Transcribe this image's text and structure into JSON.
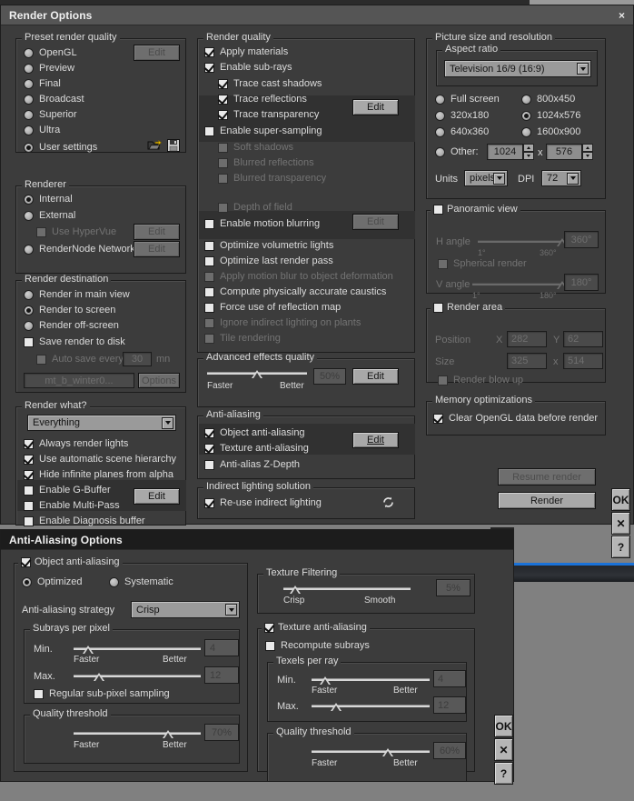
{
  "desktop": {
    "accent_color": "#1a72d8"
  },
  "render_options": {
    "title": "Render Options",
    "close_label": "×",
    "preset_render_quality": {
      "legend": "Preset render quality",
      "options": [
        "OpenGL",
        "Preview",
        "Final",
        "Broadcast",
        "Superior",
        "Ultra",
        "User settings"
      ],
      "selected": "User settings",
      "edit_label": "Edit",
      "edit_disabled": true,
      "load_icon": "folder-open-icon",
      "save_icon": "floppy-disk-icon"
    },
    "renderer": {
      "legend": "Renderer",
      "options": [
        "Internal",
        "External",
        "RenderNode Network"
      ],
      "selected": "Internal",
      "use_hypervue_label": "Use HyperVue",
      "use_hypervue_checked": false,
      "edit_external_label": "Edit",
      "edit_rendernode_label": "Edit"
    },
    "render_destination": {
      "legend": "Render destination",
      "options": [
        "Render in main view",
        "Render to screen",
        "Render off-screen"
      ],
      "selected": "Render to screen",
      "save_render_to_disk_label": "Save render to disk",
      "save_render_to_disk_checked": false,
      "auto_save_label": "Auto save every",
      "auto_save_checked": false,
      "auto_save_value": "30",
      "auto_save_unit": "mn",
      "file_name": "mt_b_winter0...",
      "options_button": "Options"
    },
    "render_what": {
      "legend": "Render what?",
      "combo_value": "Everything",
      "checkboxes": [
        {
          "label": "Always render lights",
          "checked": true
        },
        {
          "label": "Use automatic scene hierarchy",
          "checked": true
        },
        {
          "label": "Hide infinite planes from alpha",
          "checked": true
        },
        {
          "label": "Enable G-Buffer",
          "checked": false
        },
        {
          "label": "Enable Multi-Pass",
          "checked": false
        },
        {
          "label": "Enable Diagnosis buffer",
          "checked": false
        }
      ],
      "edit_label": "Edit"
    },
    "render_quality": {
      "legend": "Render quality",
      "items": [
        {
          "label": "Apply materials",
          "checked": true,
          "disabled": false,
          "indent": 0
        },
        {
          "label": "Enable sub-rays",
          "checked": true,
          "disabled": false,
          "indent": 0
        },
        {
          "label": "Trace cast shadows",
          "checked": true,
          "disabled": false,
          "indent": 1
        },
        {
          "label": "Trace reflections",
          "checked": true,
          "disabled": false,
          "indent": 1
        },
        {
          "label": "Trace transparency",
          "checked": true,
          "disabled": false,
          "indent": 1
        },
        {
          "label": "Enable super-sampling",
          "checked": false,
          "disabled": false,
          "indent": 0
        },
        {
          "label": "Soft shadows",
          "checked": false,
          "disabled": true,
          "indent": 1
        },
        {
          "label": "Blurred reflections",
          "checked": false,
          "disabled": true,
          "indent": 1
        },
        {
          "label": "Blurred transparency",
          "checked": false,
          "disabled": true,
          "indent": 1
        },
        {
          "label": "Depth of field",
          "checked": false,
          "disabled": true,
          "indent": 1
        },
        {
          "label": "Enable motion blurring",
          "checked": false,
          "disabled": false,
          "indent": 0
        },
        {
          "label": "Optimize volumetric lights",
          "checked": false,
          "disabled": false,
          "indent": 0
        },
        {
          "label": "Optimize last render pass",
          "checked": false,
          "disabled": false,
          "indent": 0
        },
        {
          "label": "Apply motion blur to object deformation",
          "checked": false,
          "disabled": true,
          "indent": 0
        },
        {
          "label": "Compute physically accurate caustics",
          "checked": false,
          "disabled": false,
          "indent": 0
        },
        {
          "label": "Force use of reflection map",
          "checked": false,
          "disabled": false,
          "indent": 0
        },
        {
          "label": "Ignore indirect lighting on plants",
          "checked": false,
          "disabled": true,
          "indent": 0
        },
        {
          "label": "Tile rendering",
          "checked": false,
          "disabled": true,
          "indent": 0
        }
      ],
      "edit_subrays_label": "Edit",
      "edit_motionblur_label": "Edit"
    },
    "advanced_effects_quality": {
      "legend": "Advanced effects quality",
      "slider_left": "Faster",
      "slider_right": "Better",
      "value": "50%",
      "slider_percent": 50,
      "edit_label": "Edit"
    },
    "anti_aliasing": {
      "legend": "Anti-aliasing",
      "items": [
        {
          "label": "Object anti-aliasing",
          "checked": true
        },
        {
          "label": "Texture anti-aliasing",
          "checked": true
        },
        {
          "label": "Anti-alias Z-Depth",
          "checked": false
        }
      ],
      "edit_label": "Edit"
    },
    "indirect_lighting": {
      "legend": "Indirect lighting solution",
      "reuse_label": "Re-use indirect lighting",
      "reuse_checked": true,
      "refresh_icon": "refresh-cycle-icon"
    },
    "picture_size": {
      "legend": "Picture size and resolution",
      "aspect_ratio_legend": "Aspect ratio",
      "aspect_ratio_value": "Television 16/9 (16:9)",
      "presets": [
        "Full screen",
        "800x450",
        "320x180",
        "1024x576",
        "640x360",
        "1600x900"
      ],
      "selected_preset": "1024x576",
      "other_label": "Other:",
      "other_width": "1024",
      "other_sep": "x",
      "other_height": "576",
      "units_label": "Units",
      "units_value": "pixels",
      "dpi_label": "DPI",
      "dpi_value": "72"
    },
    "panoramic_view": {
      "legend": "Panoramic view",
      "enabled": false,
      "h_angle_label": "H angle",
      "h_angle_value": "360°",
      "h_angle_min": "1°",
      "h_angle_max": "360°",
      "spherical_label": "Spherical render",
      "spherical_checked": false,
      "v_angle_label": "V angle",
      "v_angle_value": "180°",
      "v_angle_min": "1°",
      "v_angle_max": "180°"
    },
    "render_area": {
      "legend": "Render area",
      "enabled": false,
      "position_label": "Position",
      "x_label": "X",
      "x_value": "282",
      "y_label": "Y",
      "y_value": "62",
      "size_label": "Size",
      "size_w": "325",
      "size_sep": "x",
      "size_h": "514",
      "blow_up_label": "Render blow up",
      "blow_up_checked": false
    },
    "memory_optimizations": {
      "legend": "Memory optimizations",
      "clear_opengl_label": "Clear OpenGL data before render",
      "clear_opengl_checked": true
    },
    "actions": {
      "resume_render": "Resume render",
      "resume_disabled": true,
      "render": "Render"
    },
    "side_buttons": [
      {
        "name": "ok",
        "label": "OK"
      },
      {
        "name": "cancel",
        "label": "✕"
      },
      {
        "name": "help",
        "label": "?"
      }
    ]
  },
  "aa_options": {
    "title": "Anti-Aliasing Options",
    "object_aa": {
      "legend": "Object anti-aliasing",
      "checked": true,
      "modes": [
        "Optimized",
        "Systematic"
      ],
      "selected_mode": "Optimized",
      "strategy_label": "Anti-aliasing strategy",
      "strategy_value": "Crisp",
      "subrays": {
        "legend": "Subrays per pixel",
        "min_label": "Min.",
        "min_value": "4",
        "min_percent": 7,
        "max_label": "Max.",
        "max_value": "12",
        "max_percent": 16,
        "faster": "Faster",
        "better": "Better"
      },
      "regular_sampling_label": "Regular sub-pixel sampling",
      "regular_sampling_checked": false,
      "quality_threshold": {
        "legend": "Quality threshold",
        "value": "70%",
        "percent": 70,
        "faster": "Faster",
        "better": "Better"
      }
    },
    "texture_filtering": {
      "legend": "Texture Filtering",
      "value": "5%",
      "percent": 5,
      "left": "Crisp",
      "right": "Smooth"
    },
    "texture_aa": {
      "legend": "Texture anti-aliasing",
      "checked": true,
      "recompute_label": "Recompute subrays",
      "recompute_checked": false,
      "texels": {
        "legend": "Texels per ray",
        "min_label": "Min.",
        "min_value": "4",
        "min_percent": 7,
        "max_label": "Max.",
        "max_value": "12",
        "max_percent": 16,
        "faster": "Faster",
        "better": "Better"
      },
      "quality_threshold": {
        "legend": "Quality threshold",
        "value": "60%",
        "percent": 60,
        "faster": "Faster",
        "better": "Better"
      }
    },
    "side_buttons": [
      {
        "name": "ok",
        "label": "OK"
      },
      {
        "name": "cancel",
        "label": "✕"
      },
      {
        "name": "help",
        "label": "?"
      }
    ]
  }
}
